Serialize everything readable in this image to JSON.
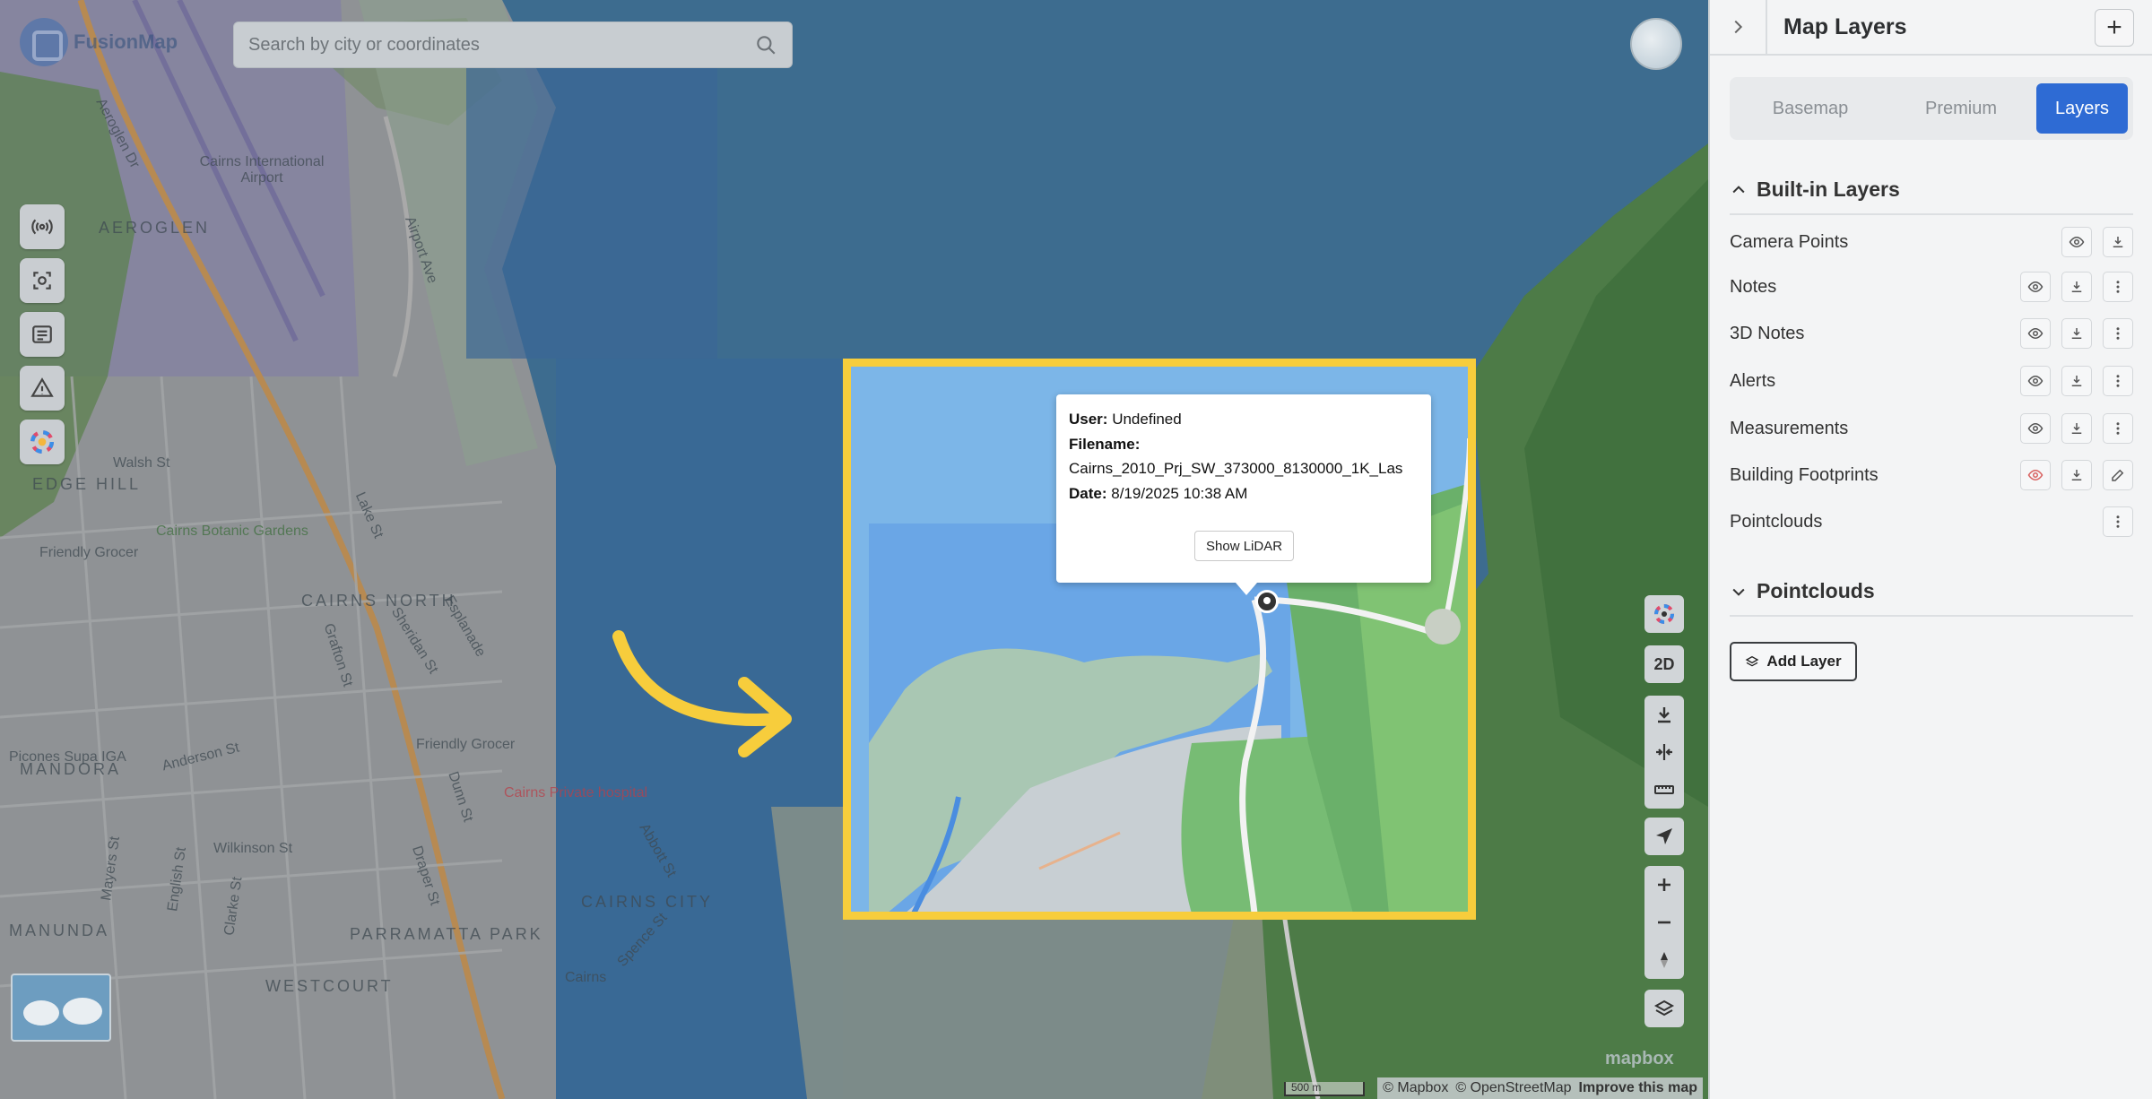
{
  "app": {
    "name": "FusionMap"
  },
  "search": {
    "placeholder": "Search by city or coordinates"
  },
  "map": {
    "labels": [
      "AEROGLEN",
      "EDGE HILL",
      "CAIRNS NORTH",
      "MANDORA",
      "PARRAMATTA PARK",
      "WESTCOURT",
      "CAIRNS CITY",
      "MANUNDA",
      "Cairns Botanic Gardens",
      "Friendly Grocer",
      "Friendly Grocer",
      "Cairns Private hospital",
      "Picones Supa IGA",
      "Cairns International Airport",
      "Walsh St",
      "Anderson St",
      "Wilkinson St",
      "Esplanade",
      "Sheridan St",
      "Airport Ave",
      "Aeroglen Dr",
      "Abbott St",
      "Spence St",
      "Lake St",
      "Grafton St",
      "Draper St",
      "Dunn St",
      "Mayers St",
      "English St",
      "Clarke St",
      "Cairns"
    ],
    "attribution": {
      "mapbox": "© Mapbox",
      "osm": "© OpenStreetMap",
      "improve": "Improve this map"
    },
    "scale": "500 m",
    "watermark": "mapbox"
  },
  "popup": {
    "user_label": "User:",
    "user_value": "Undefined",
    "filename_label": "Filename:",
    "filename_value": "Cairns_2010_Prj_SW_373000_8130000_1K_Las",
    "date_label": "Date:",
    "date_value": "8/19/2025 10:38 AM",
    "button": "Show LiDAR"
  },
  "right_tools": {
    "mode": "2D"
  },
  "highlight_color": "#f7cd3c",
  "panel": {
    "title": "Map Layers",
    "add_symbol": "+",
    "tabs": [
      {
        "label": "Basemap",
        "active": false
      },
      {
        "label": "Premium",
        "active": false
      },
      {
        "label": "Layers",
        "active": true
      }
    ],
    "built_in": {
      "title": "Built-in Layers",
      "items": [
        {
          "label": "Camera Points",
          "icons": [
            "eye-icon",
            "download-icon"
          ]
        },
        {
          "label": "Notes",
          "icons": [
            "eye-icon",
            "download-icon",
            "more-icon"
          ]
        },
        {
          "label": "3D Notes",
          "icons": [
            "eye-icon",
            "download-icon",
            "more-icon"
          ]
        },
        {
          "label": "Alerts",
          "icons": [
            "eye-icon",
            "download-icon",
            "more-icon"
          ]
        },
        {
          "label": "Measurements",
          "icons": [
            "eye-icon",
            "download-icon",
            "more-icon"
          ]
        },
        {
          "label": "Building Footprints",
          "icons": [
            "eye-icon",
            "download-icon",
            "edit-icon"
          ]
        },
        {
          "label": "Pointclouds",
          "icons": [
            "more-icon"
          ]
        }
      ]
    },
    "pointclouds": {
      "title": "Pointclouds",
      "add_button": "Add Layer"
    }
  },
  "accent_color": "#2e6bd4"
}
